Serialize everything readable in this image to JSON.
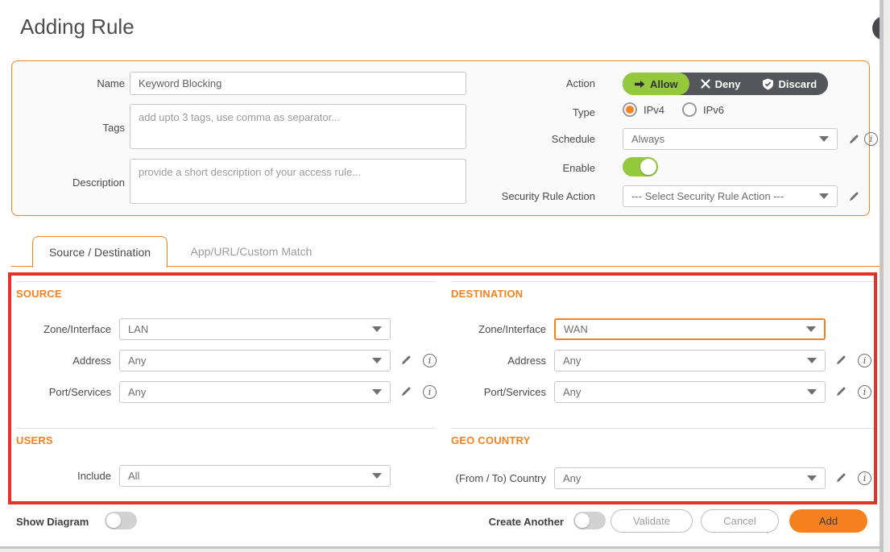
{
  "dialog": {
    "title": "Adding Rule"
  },
  "colors": {
    "accent": "#F6821F",
    "allow_green": "#94c83d",
    "segment_dark": "#54565b",
    "annotation_red": "#e53228"
  },
  "form": {
    "name": {
      "label": "Name",
      "value": "Keyword Blocking"
    },
    "tags": {
      "label": "Tags",
      "placeholder": "add upto 3 tags, use comma as separator..."
    },
    "description": {
      "label": "Description",
      "placeholder": "provide a short description of your access rule..."
    },
    "action": {
      "label": "Action",
      "options": {
        "allow": "Allow",
        "deny": "Deny",
        "discard": "Discard"
      },
      "selected": "Allow"
    },
    "type": {
      "label": "Type",
      "ipv4": "IPv4",
      "ipv6": "IPv6",
      "selected": "IPv4"
    },
    "schedule": {
      "label": "Schedule",
      "value": "Always"
    },
    "enable": {
      "label": "Enable",
      "state": "on"
    },
    "security_rule_action": {
      "label": "Security Rule Action",
      "value": "--- Select Security Rule Action ---"
    }
  },
  "tabs": {
    "source_destination": {
      "label": "Source / Destination",
      "active": true
    },
    "app_url_custom": {
      "label": "App/URL/Custom Match",
      "active": false
    }
  },
  "sections": {
    "source": {
      "title": "SOURCE",
      "zone": {
        "label": "Zone/Interface",
        "value": "LAN"
      },
      "address": {
        "label": "Address",
        "value": "Any"
      },
      "port": {
        "label": "Port/Services",
        "value": "Any"
      }
    },
    "destination": {
      "title": "DESTINATION",
      "zone": {
        "label": "Zone/Interface",
        "value": "WAN"
      },
      "address": {
        "label": "Address",
        "value": "Any"
      },
      "port": {
        "label": "Port/Services",
        "value": "Any"
      }
    },
    "users": {
      "title": "USERS",
      "include": {
        "label": "Include",
        "value": "All"
      }
    },
    "geo": {
      "title": "GEO COUNTRY",
      "country": {
        "label": "(From / To) Country",
        "value": "Any"
      }
    }
  },
  "footer": {
    "show_diagram": "Show Diagram",
    "create_another": "Create Another",
    "validate": "Validate",
    "cancel": "Cancel",
    "add": "Add"
  }
}
